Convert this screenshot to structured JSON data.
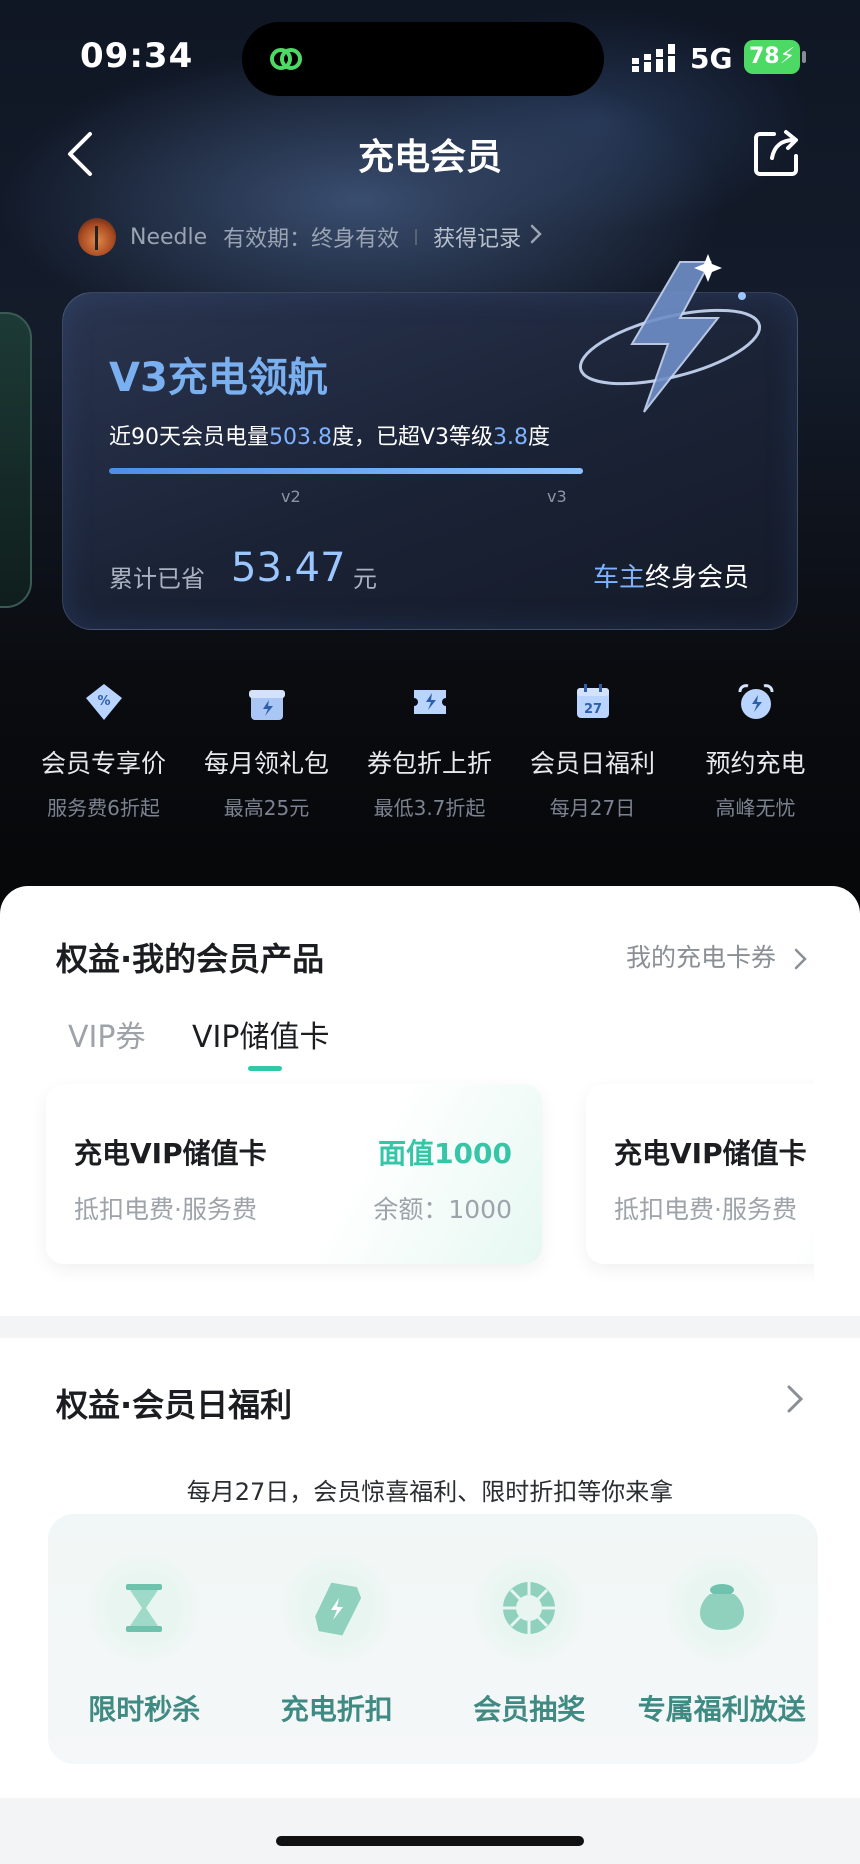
{
  "status_bar": {
    "time": "09:34",
    "network": "5G",
    "battery": "78"
  },
  "nav": {
    "title": "充电会员"
  },
  "user": {
    "name": "Needle",
    "validity": "有效期：终身有效",
    "record_link": "获得记录"
  },
  "level_card": {
    "title": "V3充电领航",
    "desc_prefix": "近90天会员电量",
    "power": "503.8",
    "desc_mid": "度，已超V3等级",
    "exceed": "3.8",
    "desc_suffix": "度",
    "progress_percent": 100,
    "tick_v2": "v2",
    "tick_v3": "v3",
    "saved_label": "累计已省",
    "saved_value": "53.47",
    "saved_unit": "元",
    "member_prefix": "车主",
    "member_suffix": "终身会员"
  },
  "benefits": [
    {
      "label": "会员专享价",
      "sub": "服务费6折起",
      "icon": "percent-tag-icon"
    },
    {
      "label": "每月领礼包",
      "sub": "最高25元",
      "icon": "gift-icon"
    },
    {
      "label": "券包折上折",
      "sub": "最低3.7折起",
      "icon": "coupon-icon"
    },
    {
      "label": "会员日福利",
      "sub": "每月27日",
      "icon": "calendar-icon"
    },
    {
      "label": "预约充电",
      "sub": "高峰无忧",
      "icon": "alarm-clock-icon"
    }
  ],
  "products": {
    "title": "权益·我的会员产品",
    "link": "我的充电卡券",
    "tabs": [
      "VIP券",
      "VIP储值卡"
    ],
    "cards": [
      {
        "title": "充电VIP储值卡",
        "sub": "抵扣电费·服务费",
        "face": "面值1000",
        "balance": "余额：1000"
      },
      {
        "title": "充电VIP储值卡",
        "sub": "抵扣电费·服务费"
      }
    ]
  },
  "member_day": {
    "title": "权益·会员日福利",
    "desc": "每月27日，会员惊喜福利、限时折扣等你来拿",
    "items": [
      {
        "label": "限时秒杀",
        "icon": "hourglass-icon"
      },
      {
        "label": "充电折扣",
        "icon": "charge-tag-icon"
      },
      {
        "label": "会员抽奖",
        "icon": "lottery-wheel-icon"
      },
      {
        "label": "专属福利放送",
        "icon": "money-bag-icon"
      }
    ]
  },
  "colors": {
    "accent_green": "#36c5a6",
    "accent_blue": "#7fb3ff"
  }
}
